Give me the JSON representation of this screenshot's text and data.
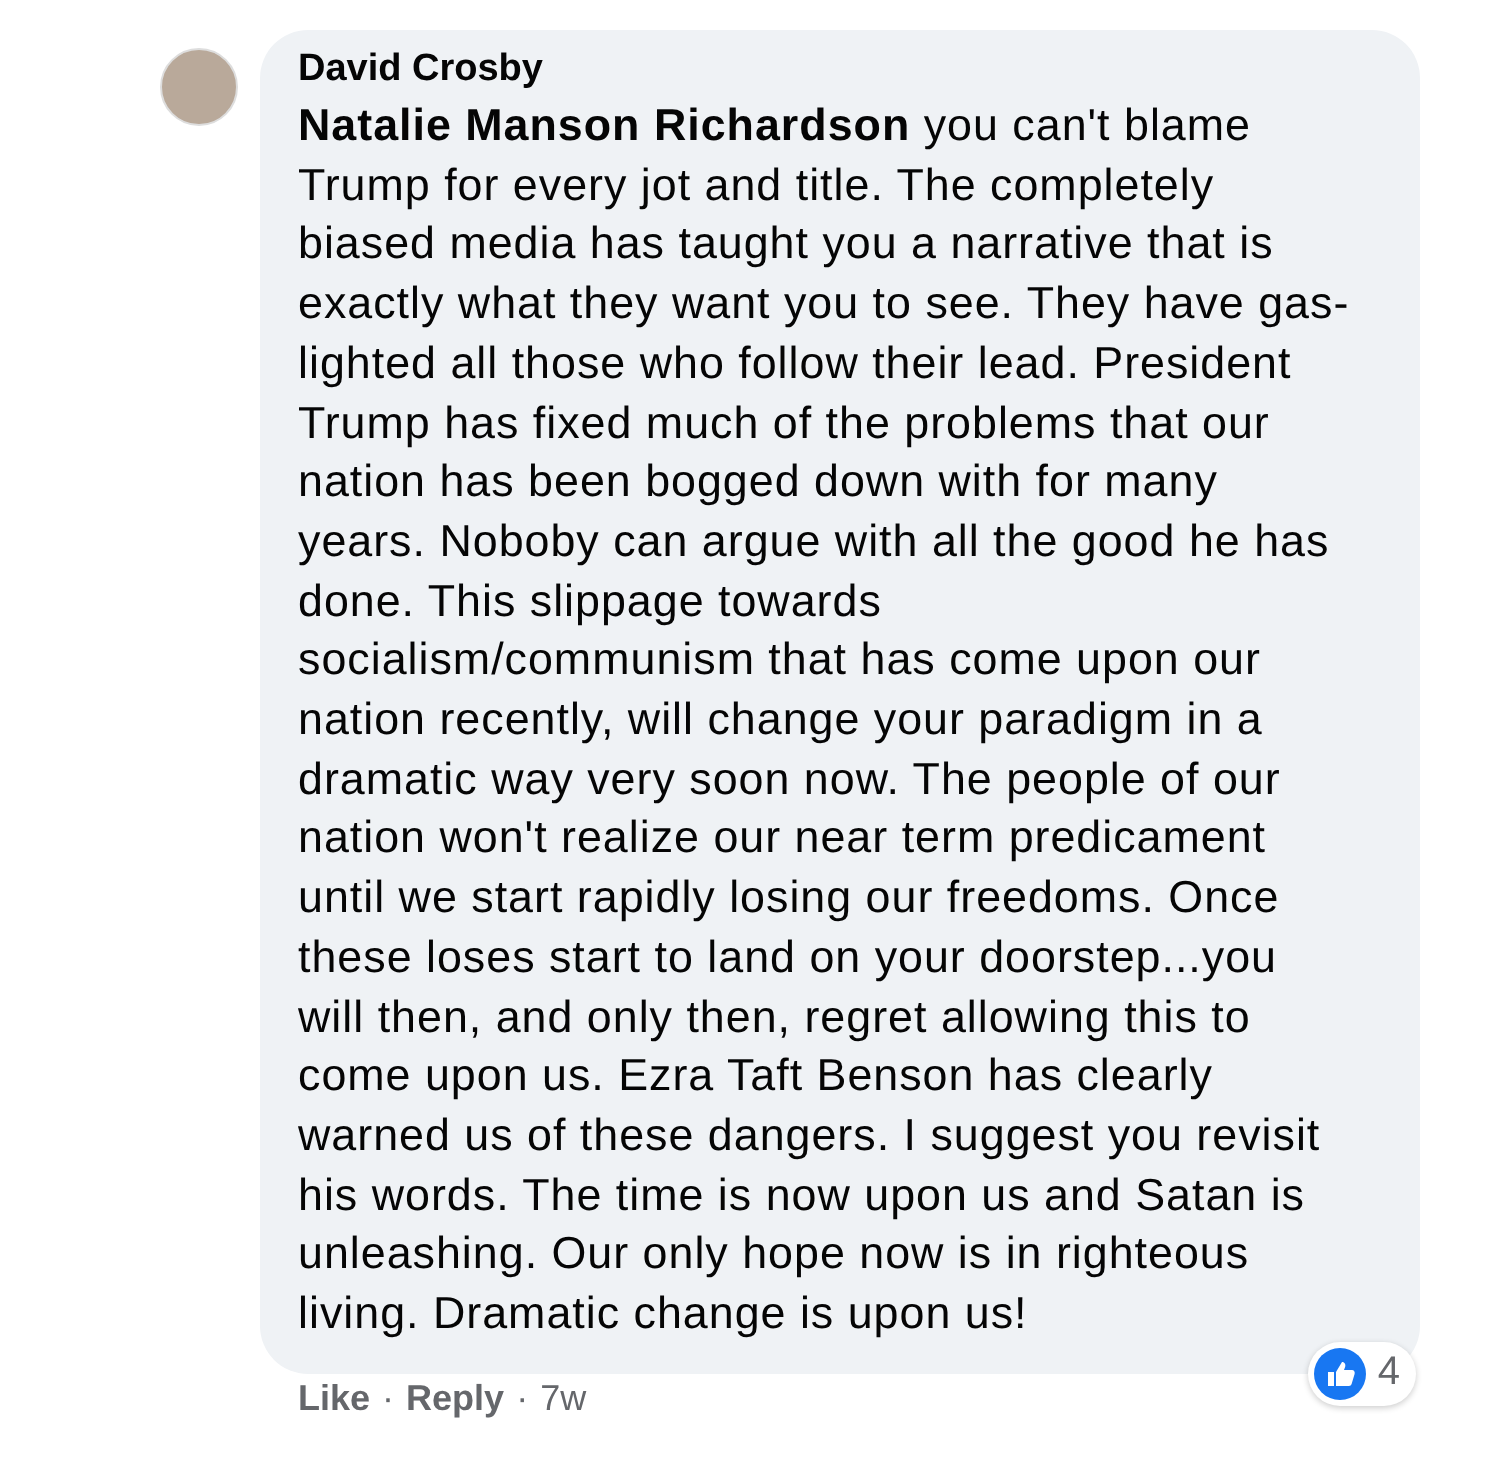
{
  "comment": {
    "author": "David Crosby",
    "text": "**Natalie Manson Richardson** you can't blame Trump for every jot and title. The completely biased media has taught you a narrative that is exactly what they want you to see. They have gas-lighted all those who follow their lead. President Trump has fixed much of the problems that our nation has been bogged down with for many years. Noboby can argue with all the good he has done. This slippage towards socialism/communism that has come upon our nation recently, will change your paradigm in a dramatic way very soon now. The people of our nation won't realize our near term predicament until we start rapidly losing our freedoms. Once these loses start to land on your doorstep...you will then, and only then, regret allowing this to come upon us. Ezra Taft Benson has clearly warned us of these dangers. I suggest you revisit his words. The time is now upon us and Satan is unleashing. Our only hope now is in righteous living. Dramatic change is upon us!",
    "reaction_count": "4",
    "actions": [
      {
        "label": "Like"
      },
      {
        "label": "Reply"
      }
    ],
    "separator": "·",
    "time": "7w"
  }
}
